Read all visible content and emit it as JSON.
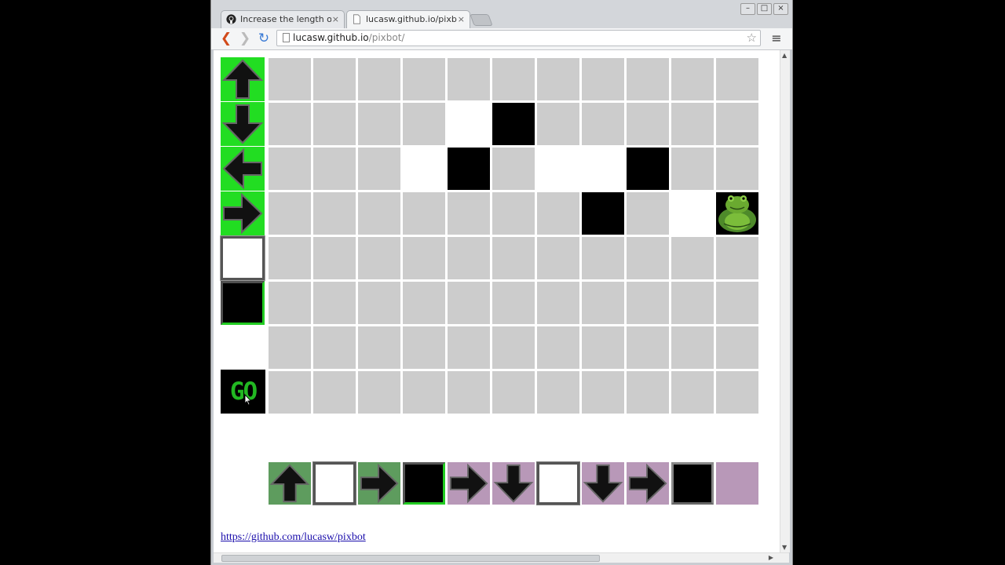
{
  "browser": {
    "tabs": [
      {
        "title": "Increase the length of the",
        "favicon": "github-icon",
        "active": false
      },
      {
        "title": "lucasw.github.io/pixbot/",
        "favicon": "page-icon",
        "active": true
      }
    ],
    "close_glyph": "×",
    "window_controls": {
      "minimize": "–",
      "maximize": "□",
      "close": "×"
    },
    "url": {
      "host": "lucasw.github.io",
      "path": "/pixbot/"
    }
  },
  "page": {
    "commands": [
      {
        "name": "up-arrow-command",
        "icon": "arrow-up-icon",
        "color": "#22dd22"
      },
      {
        "name": "down-arrow-command",
        "icon": "arrow-down-icon",
        "color": "#22dd22"
      },
      {
        "name": "left-arrow-command",
        "icon": "arrow-left-icon",
        "color": "#22dd22"
      },
      {
        "name": "right-arrow-command",
        "icon": "arrow-right-icon",
        "color": "#22dd22"
      },
      {
        "name": "white-paint-command",
        "icon": "white-square-icon"
      },
      {
        "name": "black-paint-command",
        "icon": "black-square-icon"
      }
    ],
    "go_label": "GO",
    "grid": {
      "rows": 8,
      "cols": 11,
      "white_cells": [
        [
          1,
          4
        ],
        [
          2,
          3
        ],
        [
          2,
          6
        ],
        [
          2,
          7
        ],
        [
          3,
          9
        ]
      ],
      "black_cells": [
        [
          1,
          5
        ],
        [
          2,
          4
        ],
        [
          2,
          8
        ],
        [
          3,
          7
        ]
      ],
      "robot_cell": [
        3,
        10
      ]
    },
    "program": [
      {
        "icon": "arrow-up-icon",
        "bg": "green"
      },
      {
        "icon": "white-square-icon",
        "bg": "green"
      },
      {
        "icon": "arrow-right-icon",
        "bg": "green"
      },
      {
        "icon": "black-square-icon",
        "bg": "green"
      },
      {
        "icon": "arrow-right-icon",
        "bg": "purple"
      },
      {
        "icon": "arrow-down-icon",
        "bg": "purple"
      },
      {
        "icon": "white-square-icon",
        "bg": "purple"
      },
      {
        "icon": "arrow-down-icon",
        "bg": "purple"
      },
      {
        "icon": "arrow-right-icon",
        "bg": "purple"
      },
      {
        "icon": "black-square-icon",
        "bg": "purple"
      },
      {
        "icon": "empty",
        "bg": "purple"
      }
    ],
    "link": "https://github.com/lucasw/pixbot"
  },
  "colors": {
    "grid_gray": "#cccccc",
    "command_green": "#22dd22",
    "program_green": "#5e9c5e",
    "program_purple": "#b898b8",
    "go_text": "#22b822"
  }
}
